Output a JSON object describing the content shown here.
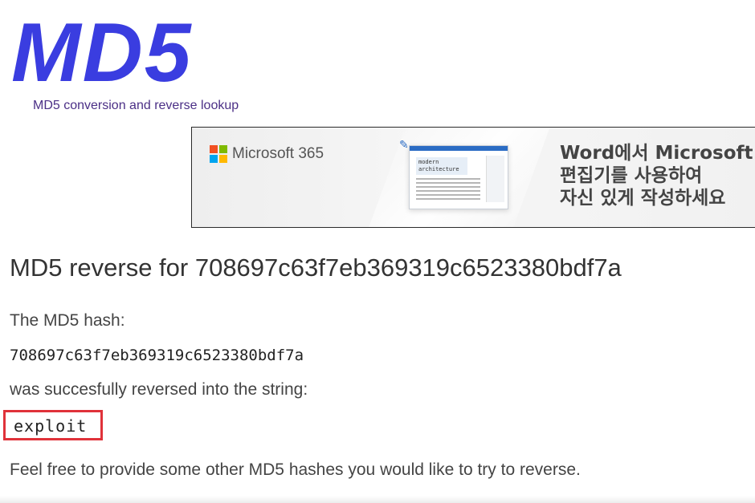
{
  "header": {
    "logo": "MD5",
    "tagline": "MD5 conversion and reverse lookup"
  },
  "ad": {
    "brand": "Microsoft 365",
    "doc_card_text": "modern architecture",
    "headline_lines": [
      "Word에서 Microsoft",
      "편집기를 사용하여",
      "자신 있게 작성하세요"
    ]
  },
  "main": {
    "heading": "MD5 reverse for 708697c63f7eb369319c6523380bdf7a",
    "hash_label": "The MD5 hash:",
    "hash_value": "708697c63f7eb369319c6523380bdf7a",
    "reversed_label": "was succesfully reversed into the string:",
    "result": "exploit",
    "footer_text": "Feel free to provide some other MD5 hashes you would like to try to reverse."
  },
  "colors": {
    "logo": "#3a3de0",
    "tagline": "#4b2f86",
    "highlight_border": "#e0323a"
  }
}
